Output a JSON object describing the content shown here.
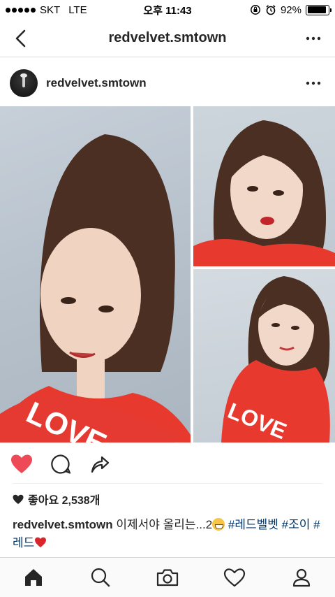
{
  "status_bar": {
    "carrier": "SKT",
    "network": "LTE",
    "time": "오후 11:43",
    "battery_percent": "92%",
    "battery_level": 0.92
  },
  "nav": {
    "title": "redvelvet.smtown",
    "back_icon": "chevron-left-icon",
    "more_icon": "more-horizontal-icon"
  },
  "post": {
    "username": "redvelvet.smtown",
    "likes_text": "좋아요 2,538개",
    "caption": {
      "username": "redvelvet.smtown",
      "text": "이제서야 올리는...2",
      "hashtags": [
        "#레드벨벳",
        "#조이",
        "#레드"
      ]
    }
  },
  "actions": {
    "like_icon": "heart-filled-icon",
    "comment_icon": "comment-icon",
    "share_icon": "share-icon"
  },
  "tab_bar": {
    "items": [
      "home-icon",
      "search-icon",
      "camera-icon",
      "heart-outline-icon",
      "profile-icon"
    ]
  },
  "colors": {
    "like_red": "#ed4956",
    "hashtag_blue": "#003569",
    "divider": "#dbdbdb"
  }
}
